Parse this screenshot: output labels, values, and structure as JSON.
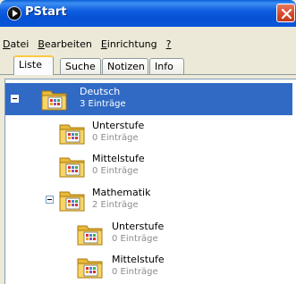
{
  "window": {
    "title": "PStart"
  },
  "menu": [
    {
      "underline": "D",
      "rest": "atei"
    },
    {
      "underline": "B",
      "rest": "earbeiten"
    },
    {
      "underline": "E",
      "rest": "inrichtung"
    },
    {
      "underline": "?",
      "rest": ""
    }
  ],
  "tabs": [
    "Liste",
    "Suche",
    "Notizen",
    "Info"
  ],
  "tree": [
    {
      "label": "Deutsch",
      "count": "3 Einträge",
      "selected": true
    },
    {
      "label": "Unterstufe",
      "count": "0 Einträge"
    },
    {
      "label": "Mittelstufe",
      "count": "0 Einträge"
    },
    {
      "label": "Mathematik",
      "count": "2 Einträge"
    },
    {
      "label": "Unterstufe",
      "count": "0 Einträge"
    },
    {
      "label": "Mittelstufe",
      "count": "0 Einträge"
    }
  ],
  "icons": {
    "app": "pstart-logo-icon",
    "close": "close-icon",
    "folder": "folder-icon",
    "collapse": "minus-icon"
  }
}
